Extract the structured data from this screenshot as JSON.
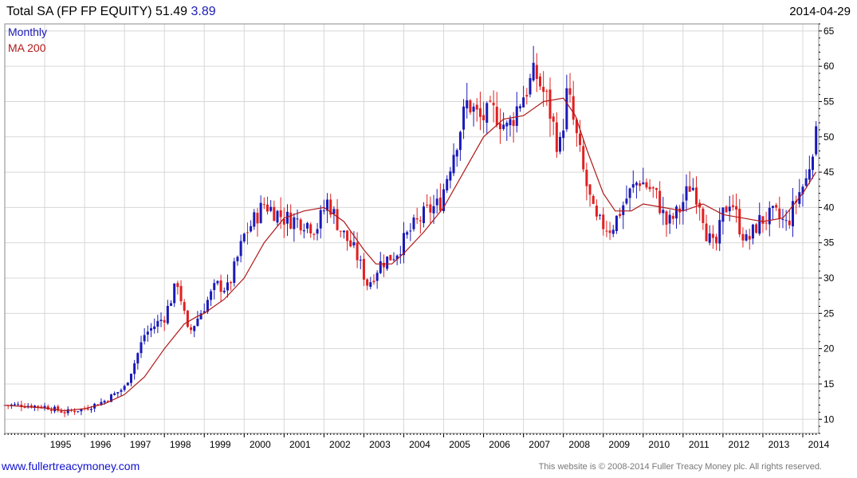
{
  "header": {
    "title": "Total SA (FP FP EQUITY) 51.49",
    "change": "3.89",
    "date": "2014-04-29"
  },
  "footer": {
    "site": "www.fullertreacymoney.com",
    "copyright": "This website is © 2008-2014 Fuller Treacy Money plc. All rights reserved."
  },
  "colors": {
    "up": "#1a1ab8",
    "down": "#e02020",
    "ma": "#b01818",
    "grid": "#d8d8d8",
    "frame": "#000000"
  },
  "chart_data": {
    "type": "candlestick",
    "legend": [
      "Monthly",
      "MA 200"
    ],
    "legend_position": "top-left",
    "ylim": [
      8,
      66
    ],
    "yticks": [
      10,
      15,
      20,
      25,
      30,
      35,
      40,
      45,
      50,
      55,
      60,
      65
    ],
    "xlim": [
      1994.0,
      2014.4
    ],
    "xticks": [
      "1995",
      "1996",
      "1997",
      "1998",
      "1999",
      "2000",
      "2001",
      "2002",
      "2003",
      "2004",
      "2005",
      "2006",
      "2007",
      "2008",
      "2009",
      "2010",
      "2011",
      "2012",
      "2013",
      "2014"
    ],
    "grid": true,
    "series": [
      {
        "name": "Monthly",
        "anchors": [
          [
            1994.0,
            12.0
          ],
          [
            1994.5,
            12.0
          ],
          [
            1995.0,
            11.8
          ],
          [
            1995.5,
            11.0
          ],
          [
            1996.0,
            11.5
          ],
          [
            1996.5,
            12.6
          ],
          [
            1997.0,
            14.5
          ],
          [
            1997.25,
            18.0
          ],
          [
            1997.5,
            22.0
          ],
          [
            1998.0,
            24.5
          ],
          [
            1998.33,
            29.5
          ],
          [
            1998.6,
            22.0
          ],
          [
            1998.9,
            25.0
          ],
          [
            1999.3,
            29.0
          ],
          [
            1999.6,
            28.5
          ],
          [
            2000.0,
            36.0
          ],
          [
            2000.5,
            40.5
          ],
          [
            2001.0,
            38.5
          ],
          [
            2001.5,
            38.0
          ],
          [
            2001.8,
            37.0
          ],
          [
            2002.1,
            41.0
          ],
          [
            2002.4,
            37.0
          ],
          [
            2002.8,
            33.5
          ],
          [
            2003.1,
            29.0
          ],
          [
            2003.4,
            32.0
          ],
          [
            2003.8,
            33.5
          ],
          [
            2004.2,
            37.0
          ],
          [
            2004.6,
            39.5
          ],
          [
            2004.9,
            40.5
          ],
          [
            2005.2,
            47.0
          ],
          [
            2005.6,
            55.0
          ],
          [
            2005.9,
            52.5
          ],
          [
            2006.3,
            53.5
          ],
          [
            2006.6,
            51.0
          ],
          [
            2006.9,
            55.0
          ],
          [
            2007.3,
            59.0
          ],
          [
            2007.6,
            55.0
          ],
          [
            2007.9,
            48.0
          ],
          [
            2008.1,
            56.5
          ],
          [
            2008.5,
            45.0
          ],
          [
            2008.8,
            38.0
          ],
          [
            2009.2,
            37.0
          ],
          [
            2009.6,
            41.5
          ],
          [
            2009.9,
            44.0
          ],
          [
            2010.3,
            42.0
          ],
          [
            2010.6,
            37.5
          ],
          [
            2010.9,
            39.5
          ],
          [
            2011.2,
            43.5
          ],
          [
            2011.45,
            40.5
          ],
          [
            2011.6,
            36.0
          ],
          [
            2011.8,
            34.0
          ],
          [
            2012.0,
            39.0
          ],
          [
            2012.2,
            41.5
          ],
          [
            2012.4,
            37.5
          ],
          [
            2012.6,
            35.0
          ],
          [
            2012.9,
            38.0
          ],
          [
            2013.3,
            39.0
          ],
          [
            2013.6,
            37.5
          ],
          [
            2013.9,
            42.0
          ],
          [
            2014.1,
            44.0
          ],
          [
            2014.33,
            51.5
          ]
        ]
      },
      {
        "name": "MA 200",
        "points": [
          [
            1994.0,
            12.0
          ],
          [
            1995.0,
            11.6
          ],
          [
            1995.5,
            11.2
          ],
          [
            1996.0,
            11.5
          ],
          [
            1996.5,
            12.2
          ],
          [
            1997.0,
            13.5
          ],
          [
            1997.5,
            16.0
          ],
          [
            1998.0,
            20.0
          ],
          [
            1998.5,
            23.5
          ],
          [
            1998.8,
            24.5
          ],
          [
            1999.0,
            25.0
          ],
          [
            1999.5,
            27.0
          ],
          [
            2000.0,
            30.0
          ],
          [
            2000.5,
            35.0
          ],
          [
            2001.0,
            38.5
          ],
          [
            2001.5,
            39.5
          ],
          [
            2002.0,
            40.0
          ],
          [
            2002.5,
            38.0
          ],
          [
            2003.0,
            34.0
          ],
          [
            2003.3,
            32.0
          ],
          [
            2003.7,
            32.0
          ],
          [
            2004.0,
            33.5
          ],
          [
            2004.5,
            36.5
          ],
          [
            2005.0,
            40.0
          ],
          [
            2005.5,
            45.0
          ],
          [
            2006.0,
            50.0
          ],
          [
            2006.5,
            52.5
          ],
          [
            2007.0,
            53.0
          ],
          [
            2007.5,
            55.0
          ],
          [
            2008.0,
            55.5
          ],
          [
            2008.3,
            53.0
          ],
          [
            2008.6,
            48.0
          ],
          [
            2009.0,
            42.0
          ],
          [
            2009.3,
            39.5
          ],
          [
            2009.7,
            39.5
          ],
          [
            2010.0,
            40.5
          ],
          [
            2010.5,
            40.0
          ],
          [
            2011.0,
            39.5
          ],
          [
            2011.5,
            40.5
          ],
          [
            2012.0,
            39.0
          ],
          [
            2012.5,
            38.5
          ],
          [
            2013.0,
            38.0
          ],
          [
            2013.5,
            38.5
          ],
          [
            2014.0,
            42.0
          ],
          [
            2014.33,
            45.0
          ]
        ]
      }
    ]
  }
}
